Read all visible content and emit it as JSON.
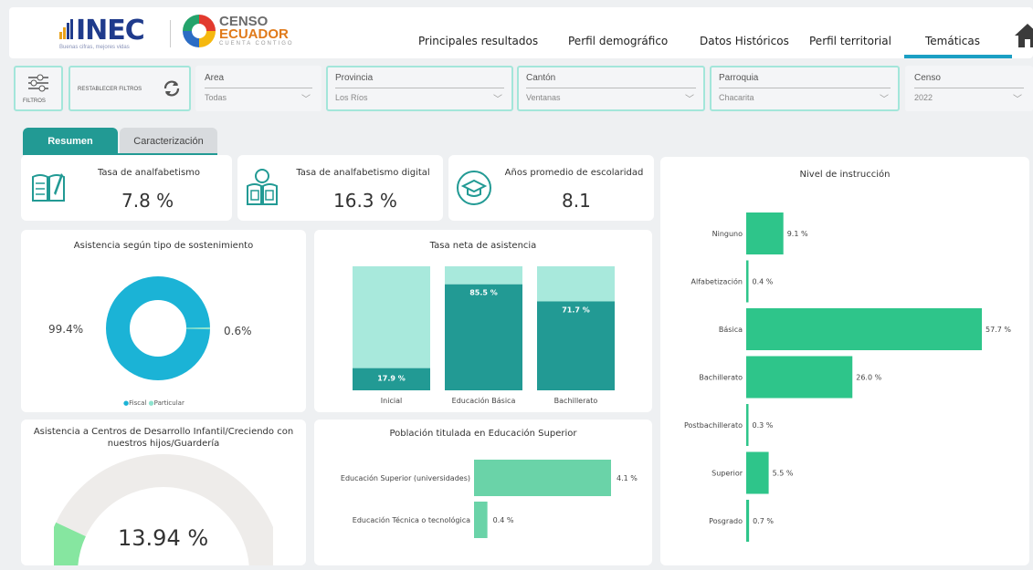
{
  "header": {
    "brand_inec": "INEC",
    "inec_tagline": "Buenas cifras, mejores vidas",
    "censo_line1": "CENSO",
    "censo_line2": "ECUADOR",
    "censo_tagline": "CUENTA CONTIGO",
    "nav": [
      "Principales resultados",
      "Perfil demográfico",
      "Datos Históricos",
      "Perfil territorial",
      "Temáticas"
    ],
    "active_nav": "Temáticas"
  },
  "filters": {
    "toggle_label": "FILTROS",
    "reset_label": "RESTABLECER FILTROS",
    "area": {
      "label": "Area",
      "value": "Todas"
    },
    "provincia": {
      "label": "Provincia",
      "value": "Los Ríos"
    },
    "canton": {
      "label": "Cantón",
      "value": "Ventanas"
    },
    "parroquia": {
      "label": "Parroquia",
      "value": "Chacarita"
    },
    "censo": {
      "label": "Censo",
      "value": "2022"
    }
  },
  "tabs": {
    "resumen": "Resumen",
    "caracterizacion": "Caracterización"
  },
  "kpis": {
    "analfabetismo": {
      "title": "Tasa de analfabetismo",
      "value": "7.8 %"
    },
    "analfabetismo_digital": {
      "title": "Tasa de analfabetismo digital",
      "value": "16.3 %"
    },
    "escolaridad": {
      "title": "Años promedio de escolaridad",
      "value": "8.1"
    }
  },
  "donut": {
    "title": "Asistencia según tipo de sostenimiento",
    "left_label": "99.4%",
    "right_label": "0.6%",
    "legend_fiscal": "Fiscal",
    "legend_particular": "Particular",
    "colors": {
      "fiscal": "#1bb3d6",
      "particular": "#8ee3cf"
    }
  },
  "gauge": {
    "title_line1": "Asistencia a Centros de Desarrollo Infantil/Creciendo con",
    "title_line2": "nuestros hijos/Guardería",
    "value_label": "13.94 %",
    "value": 13.94,
    "colors": {
      "fill": "#86e6a0",
      "track": "#eeecea"
    }
  },
  "tasa_neta": {
    "title": "Tasa neta de asistencia",
    "categories": [
      "Inicial",
      "Educación Básica",
      "Bachillerato"
    ],
    "values": [
      17.9,
      85.5,
      71.7
    ],
    "labels": [
      "17.9 %",
      "85.5 %",
      "71.7 %"
    ],
    "colors": {
      "dark": "#229a94",
      "light": "#a8e9dc"
    }
  },
  "superior": {
    "title": "Población titulada en Educación Superior",
    "categories": [
      "Educación Superior (universidades)",
      "Educación Técnica o tecnológica"
    ],
    "values": [
      4.1,
      0.4
    ],
    "labels": [
      "4.1 %",
      "0.4 %"
    ],
    "color": "#6ad3a8"
  },
  "instruccion": {
    "title": "Nivel de instrucción",
    "categories": [
      "Ninguno",
      "Alfabetización",
      "Básica",
      "Bachillerato",
      "Postbachillerato",
      "Superior",
      "Posgrado"
    ],
    "values": [
      9.1,
      0.4,
      57.7,
      26.0,
      0.3,
      5.5,
      0.7
    ],
    "labels": [
      "9.1 %",
      "0.4 %",
      "57.7 %",
      "26.0 %",
      "0.3 %",
      "5.5 %",
      "0.7 %"
    ],
    "color": "#2ec58a"
  },
  "chart_data": [
    {
      "type": "bar",
      "title": "Tasa neta de asistencia",
      "categories": [
        "Inicial",
        "Educación Básica",
        "Bachillerato"
      ],
      "values": [
        17.9,
        85.5,
        71.7
      ],
      "ylim": [
        0,
        100
      ]
    },
    {
      "type": "bar",
      "title": "Población titulada en Educación Superior",
      "categories": [
        "Educación Superior (universidades)",
        "Educación Técnica o tecnológica"
      ],
      "values": [
        4.1,
        0.4
      ]
    },
    {
      "type": "bar",
      "title": "Nivel de instrucción",
      "categories": [
        "Ninguno",
        "Alfabetización",
        "Básica",
        "Bachillerato",
        "Postbachillerato",
        "Superior",
        "Posgrado"
      ],
      "values": [
        9.1,
        0.4,
        57.7,
        26.0,
        0.3,
        5.5,
        0.7
      ]
    },
    {
      "type": "pie",
      "title": "Asistencia según tipo de sostenimiento",
      "categories": [
        "Fiscal",
        "Particular"
      ],
      "values": [
        99.4,
        0.6
      ]
    }
  ]
}
